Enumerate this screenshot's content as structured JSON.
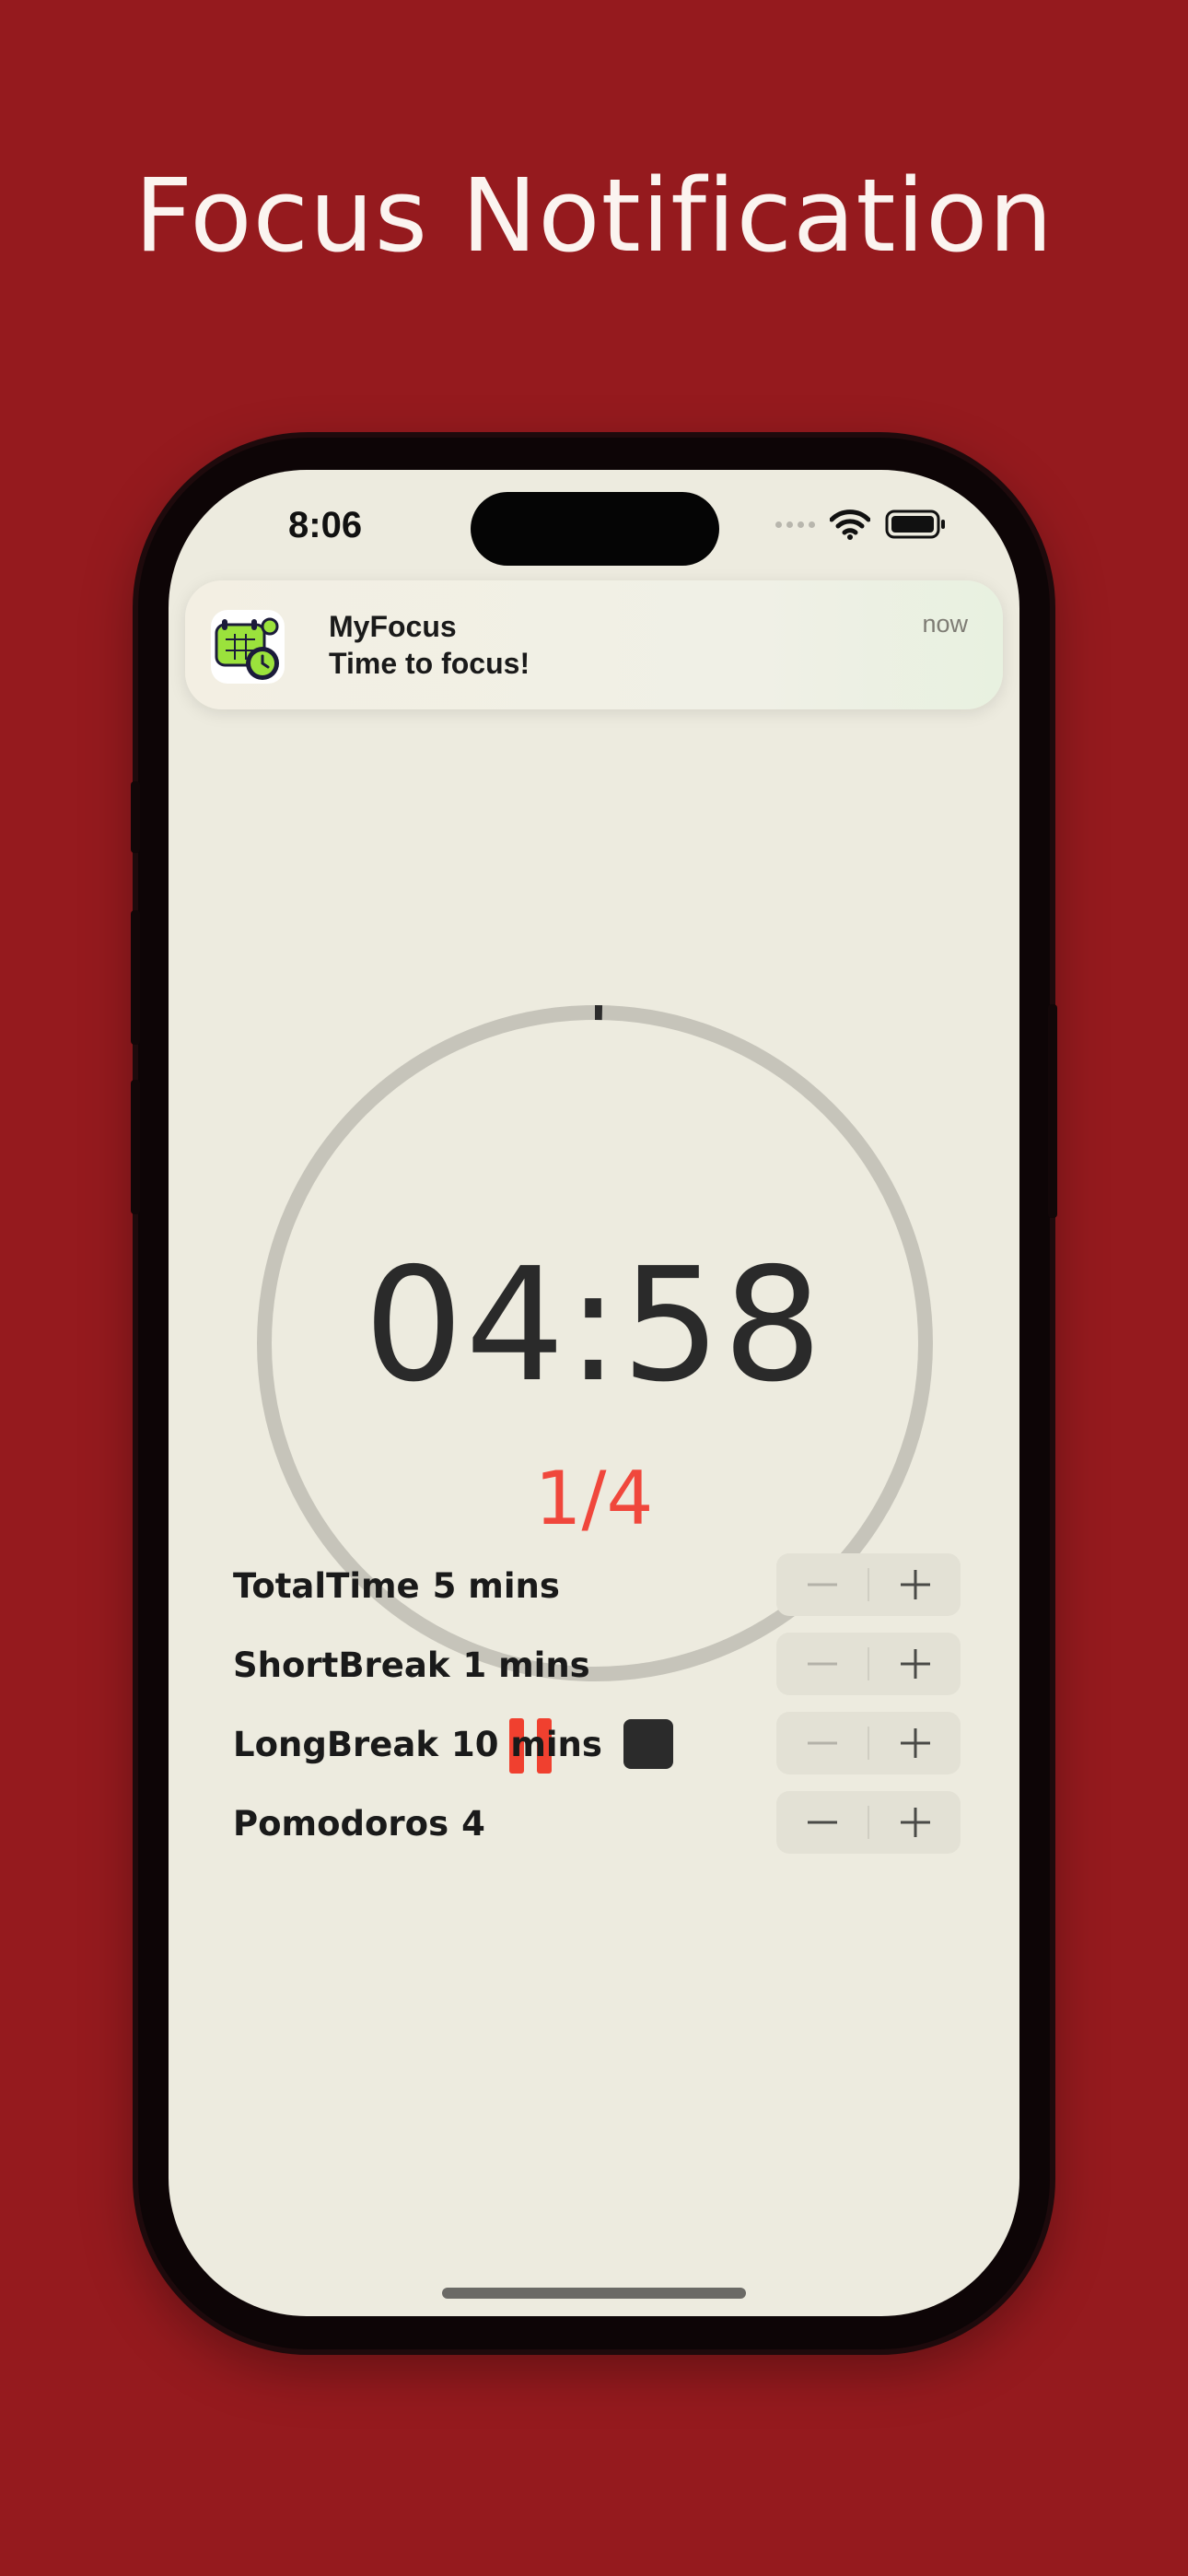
{
  "headline": "Focus Notification",
  "status_bar": {
    "time": "8:06"
  },
  "notification": {
    "app_name": "MyFocus",
    "message": "Time to focus!",
    "time": "now"
  },
  "timer": {
    "display": "04:58",
    "session_count": "1/4",
    "progress_fraction": 0.007
  },
  "settings": [
    {
      "label": "TotalTime",
      "value": "5 mins",
      "decrement_enabled": false
    },
    {
      "label": "ShortBreak",
      "value": "1 mins",
      "decrement_enabled": false
    },
    {
      "label": "LongBreak",
      "value": "10 mins",
      "decrement_enabled": false
    },
    {
      "label": "Pomodoros",
      "value": "4",
      "decrement_enabled": true
    }
  ],
  "colors": {
    "background": "#951a1e",
    "screen": "#edebdf",
    "accent": "#f0473c",
    "ring_track": "#c6c4ba",
    "ring_progress": "#2b2b2b",
    "text": "#2a2a2a"
  }
}
